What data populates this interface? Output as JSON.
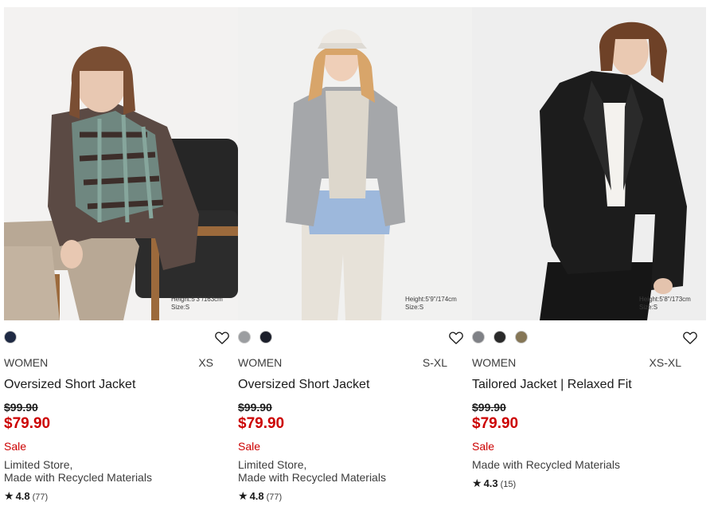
{
  "products": [
    {
      "photo": {
        "alt": "Woman seated in armchair wearing plaid jacket",
        "caption_lines": [
          "Height:5'3\"/163cm",
          "Size:S"
        ]
      },
      "swatches": [
        "#1f2a44"
      ],
      "gender": "WOMEN",
      "sizes": "XS",
      "name": "Oversized Short Jacket",
      "old_price": "$99.90",
      "new_price": "$79.90",
      "sale_label": "Sale",
      "notes": [
        "Limited Store,",
        "Made with Recycled Materials"
      ],
      "rating": {
        "star": "★",
        "score": "4.8",
        "count": "(77)"
      }
    },
    {
      "photo": {
        "alt": "Woman in cap wearing grey jacket over blue shirt",
        "caption_lines": [
          "Height:5'9\"/174cm",
          "Size:S"
        ]
      },
      "swatches": [
        "#9b9da0",
        "#1c1f2b"
      ],
      "gender": "WOMEN",
      "sizes": "S-XL",
      "name": "Oversized Short Jacket",
      "old_price": "$99.90",
      "new_price": "$79.90",
      "sale_label": "Sale",
      "notes": [
        "Limited Store,",
        "Made with Recycled Materials"
      ],
      "rating": {
        "star": "★",
        "score": "4.8",
        "count": "(77)"
      }
    },
    {
      "photo": {
        "alt": "Woman wearing black tailored jacket",
        "caption_lines": [
          "Height:5'8\"/173cm",
          "Size:S"
        ]
      },
      "swatches": [
        "#7f8186",
        "#2a2a2a",
        "#857656"
      ],
      "gender": "WOMEN",
      "sizes": "XS-XL",
      "name": "Tailored Jacket | Relaxed Fit",
      "old_price": "$99.90",
      "new_price": "$79.90",
      "sale_label": "Sale",
      "notes": [
        "Made with Recycled Materials"
      ],
      "rating": {
        "star": "★",
        "score": "4.3",
        "count": "(15)"
      }
    }
  ],
  "icons": {
    "favorite": "heart-outline-icon",
    "rating": "star-icon"
  },
  "colors": {
    "sale_red": "#cc0000",
    "text": "#1b1b1b",
    "muted": "#3d3d3d"
  }
}
